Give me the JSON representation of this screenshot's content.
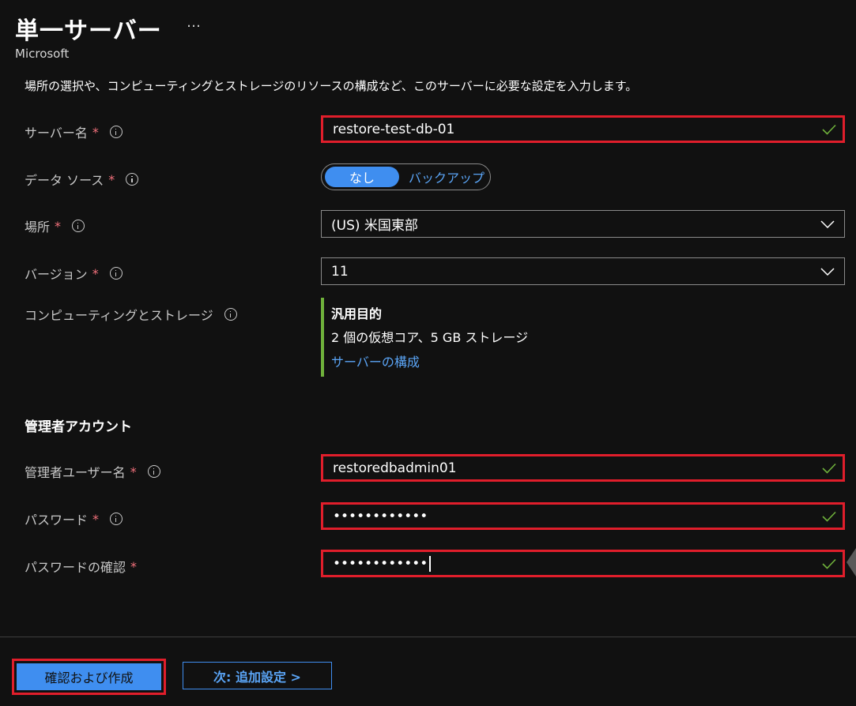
{
  "header": {
    "title": "単一サーバー",
    "more": "…",
    "publisher": "Microsoft"
  },
  "description": "場所の選択や、コンピューティングとストレージのリソースの構成など、このサーバーに必要な設定を入力します。",
  "fields": {
    "server_name": {
      "label": "サーバー名",
      "required": "*",
      "value": "restore-test-db-01"
    },
    "data_source": {
      "label": "データ ソース",
      "required": "*",
      "option_selected": "なし",
      "option_other": "バックアップ"
    },
    "location": {
      "label": "場所",
      "required": "*",
      "value": "(US) 米国東部"
    },
    "version": {
      "label": "バージョン",
      "required": "*",
      "value": "11"
    },
    "compute": {
      "label": "コンピューティングとストレージ",
      "tier": "汎用目的",
      "spec": "2 個の仮想コア、5 GB ストレージ",
      "link": "サーバーの構成"
    }
  },
  "admin": {
    "section_title": "管理者アカウント",
    "username": {
      "label": "管理者ユーザー名",
      "required": "*",
      "value": "restoredbadmin01"
    },
    "password": {
      "label": "パスワード",
      "required": "*",
      "value": "••••••••••••"
    },
    "confirm": {
      "label": "パスワードの確認",
      "required": "*",
      "value": "••••••••••••"
    }
  },
  "footer": {
    "primary": "確認および作成",
    "secondary": "次: 追加設定 >"
  },
  "colors": {
    "background": "#111111",
    "accent": "#3f8ef0",
    "link": "#5aa4f5",
    "required": "#f1707b",
    "valid": "#6fb13b",
    "highlight": "#e01e2b"
  },
  "icons": {
    "info": "info-icon",
    "valid": "check-icon",
    "dropdown": "chevron-down-icon"
  }
}
